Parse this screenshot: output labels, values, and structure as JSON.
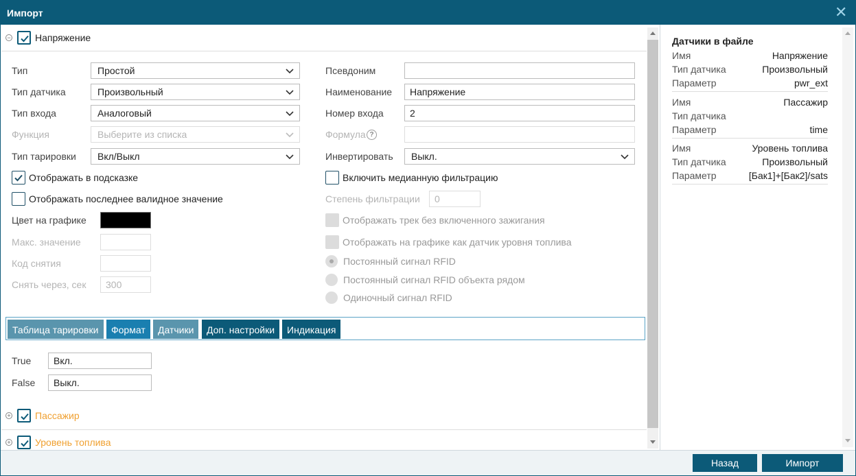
{
  "window": {
    "title": "Импорт"
  },
  "section_main": {
    "name": "Напряжение"
  },
  "left_form": {
    "type": {
      "label": "Тип",
      "value": "Простой"
    },
    "sensor_type": {
      "label": "Тип датчика",
      "value": "Произвольный"
    },
    "input_type": {
      "label": "Тип входа",
      "value": "Аналоговый"
    },
    "function": {
      "label": "Функция",
      "placeholder": "Выберите из списка"
    },
    "calibration_type": {
      "label": "Тип тарировки",
      "value": "Вкл/Выкл"
    },
    "show_in_tooltip": {
      "label": "Отображать в подсказке",
      "checked": true
    },
    "show_last_valid": {
      "label": "Отображать последнее валидное значение",
      "checked": false
    },
    "chart_color": {
      "label": "Цвет на графике",
      "color": "#000000"
    },
    "max_value": {
      "label": "Макс. значение",
      "value": ""
    },
    "removal_code": {
      "label": "Код снятия",
      "value": ""
    },
    "remove_after": {
      "label": "Снять через, сек",
      "value": "300"
    }
  },
  "right_form": {
    "alias": {
      "label": "Псевдоним",
      "value": ""
    },
    "name": {
      "label": "Наименование",
      "value": "Напряжение"
    },
    "input_number": {
      "label": "Номер входа",
      "value": "2"
    },
    "formula": {
      "label": "Формула",
      "value": ""
    },
    "invert": {
      "label": "Инвертировать",
      "value": "Выкл."
    },
    "median_filter": {
      "label": "Включить медианную фильтрацию",
      "checked": false
    },
    "filter_degree": {
      "label": "Степень фильтрации",
      "value": "0"
    },
    "track_no_ignition": {
      "label": "Отображать трек без включенного зажигания"
    },
    "fuel_level_chart": {
      "label": "Отображать на графике как датчик уровня топлива"
    },
    "rfid_constant": {
      "label": "Постоянный сигнал RFID"
    },
    "rfid_nearby": {
      "label": "Постоянный сигнал RFID объекта рядом"
    },
    "rfid_single": {
      "label": "Одиночный сигнал RFID"
    }
  },
  "tabs": [
    {
      "label": "Таблица тарировки",
      "color": "#5a95ad"
    },
    {
      "label": "Формат",
      "color": "#1a7fb0"
    },
    {
      "label": "Датчики",
      "color": "#5a95ad"
    },
    {
      "label": "Доп. настройки",
      "color": "#0c5a78"
    },
    {
      "label": "Индикация",
      "color": "#0c5a78"
    }
  ],
  "format": {
    "true": {
      "label": "True",
      "value": "Вкл."
    },
    "false": {
      "label": "False",
      "value": "Выкл."
    }
  },
  "sections_collapsed": [
    {
      "name": "Пассажир"
    },
    {
      "name": "Уровень топлива"
    }
  ],
  "sidebar": {
    "title": "Датчики в файле",
    "sensors": [
      {
        "rows": [
          {
            "key": "Имя",
            "value": "Напряжение"
          },
          {
            "key": "Тип датчика",
            "value": "Произвольный"
          },
          {
            "key": "Параметр",
            "value": "pwr_ext"
          }
        ]
      },
      {
        "rows": [
          {
            "key": "Имя",
            "value": "Пассажир"
          },
          {
            "key": "Тип датчика",
            "value": ""
          },
          {
            "key": "Параметр",
            "value": "time"
          }
        ]
      },
      {
        "rows": [
          {
            "key": "Имя",
            "value": "Уровень топлива"
          },
          {
            "key": "Тип датчика",
            "value": "Произвольный"
          },
          {
            "key": "Параметр",
            "value": "[Бак1]+[Бак2]/sats"
          }
        ]
      }
    ]
  },
  "footer": {
    "back_label": "Назад",
    "import_label": "Импорт"
  },
  "colors": {
    "primary": "#0c5a78",
    "accent": "#f0a030"
  }
}
